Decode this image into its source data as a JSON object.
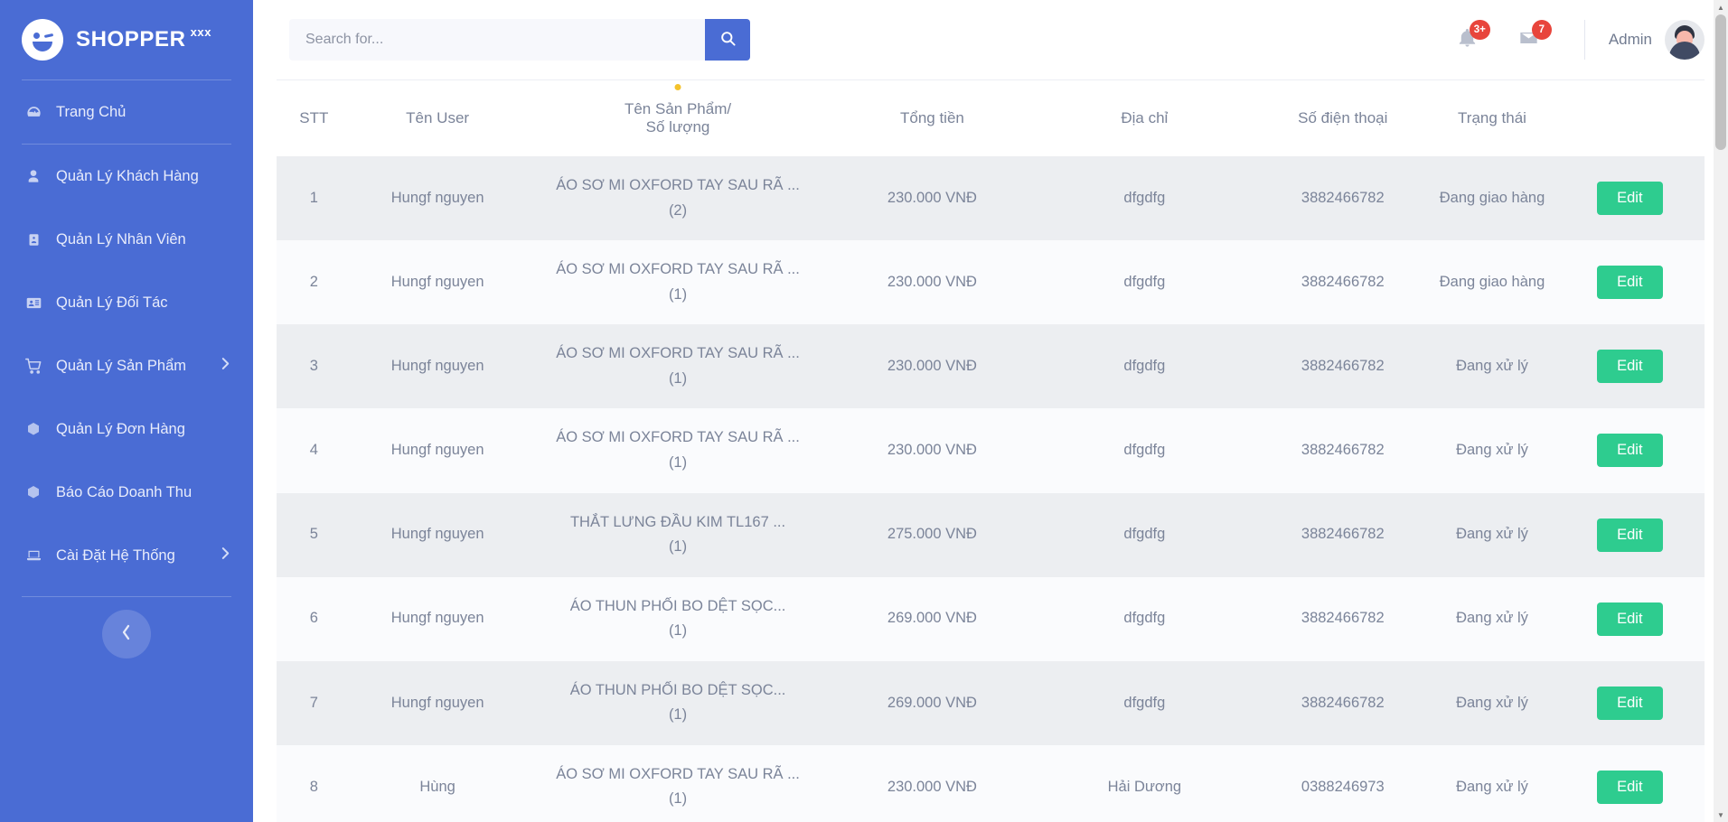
{
  "brand": {
    "name": "SHOPPER",
    "sup": "xxx",
    "logo_icon": "wink-smiley-icon"
  },
  "sidebar": {
    "items": [
      {
        "label": "Trang Chủ",
        "icon": "dashboard-icon",
        "has_arrow": false
      },
      {
        "label": "Quản Lý Khách Hàng",
        "icon": "user-icon",
        "has_arrow": false
      },
      {
        "label": "Quản Lý Nhân Viên",
        "icon": "id-badge-icon",
        "has_arrow": false
      },
      {
        "label": "Quản Lý Đối Tác",
        "icon": "id-card-icon",
        "has_arrow": false
      },
      {
        "label": "Quản Lý Sản Phẩm",
        "icon": "cart-icon",
        "has_arrow": true
      },
      {
        "label": "Quản Lý Đơn Hàng",
        "icon": "box-icon",
        "has_arrow": false
      },
      {
        "label": "Báo Cáo Doanh Thu",
        "icon": "box-icon",
        "has_arrow": false
      },
      {
        "label": "Cài Đặt Hệ Thống",
        "icon": "laptop-icon",
        "has_arrow": true
      }
    ],
    "collapse_icon": "chevron-left-icon",
    "bg_color": "#4a6cd4"
  },
  "topbar": {
    "search_placeholder": "Search for...",
    "search_value": "",
    "search_icon": "search-icon",
    "notifications": {
      "icon": "bell-icon",
      "badge": "3+"
    },
    "messages": {
      "icon": "envelope-icon",
      "badge": "7"
    },
    "user_name": "Admin",
    "avatar_icon": "avatar",
    "badge_color": "#e8453c",
    "accent_color": "#4a6cd4"
  },
  "table": {
    "headers": {
      "stt": "STT",
      "user": "Tên User",
      "product_line1": "Tên Sản Phẩm/",
      "product_line2": "Số lượng",
      "total": "Tổng tiền",
      "address": "Địa chỉ",
      "phone": "Số điện thoại",
      "status": "Trạng thái"
    },
    "action_label": "Edit",
    "action_color": "#2ecc8f",
    "rows": [
      {
        "stt": "1",
        "user": "Hungf nguyen",
        "product": "ÁO SƠ MI OXFORD TAY SAU RÃ ...",
        "qty": "(2)",
        "total": "230.000 VNĐ",
        "address": "dfgdfg",
        "phone": "3882466782",
        "status": "Đang giao hàng",
        "action": "Edit"
      },
      {
        "stt": "2",
        "user": "Hungf nguyen",
        "product": "ÁO SƠ MI OXFORD TAY SAU RÃ ...",
        "qty": "(1)",
        "total": "230.000 VNĐ",
        "address": "dfgdfg",
        "phone": "3882466782",
        "status": "Đang giao hàng",
        "action": "Edit"
      },
      {
        "stt": "3",
        "user": "Hungf nguyen",
        "product": "ÁO SƠ MI OXFORD TAY SAU RÃ ...",
        "qty": "(1)",
        "total": "230.000 VNĐ",
        "address": "dfgdfg",
        "phone": "3882466782",
        "status": "Đang xử lý",
        "action": "Edit"
      },
      {
        "stt": "4",
        "user": "Hungf nguyen",
        "product": "ÁO SƠ MI OXFORD TAY SAU RÃ ...",
        "qty": "(1)",
        "total": "230.000 VNĐ",
        "address": "dfgdfg",
        "phone": "3882466782",
        "status": "Đang xử lý",
        "action": "Edit"
      },
      {
        "stt": "5",
        "user": "Hungf nguyen",
        "product": "THẮT LƯNG ĐẦU KIM TL167 ...",
        "qty": "(1)",
        "total": "275.000 VNĐ",
        "address": "dfgdfg",
        "phone": "3882466782",
        "status": "Đang xử lý",
        "action": "Edit"
      },
      {
        "stt": "6",
        "user": "Hungf nguyen",
        "product": "ÁO THUN PHỐI BO DỆT SỌC...",
        "qty": "(1)",
        "total": "269.000 VNĐ",
        "address": "dfgdfg",
        "phone": "3882466782",
        "status": "Đang xử lý",
        "action": "Edit"
      },
      {
        "stt": "7",
        "user": "Hungf nguyen",
        "product": "ÁO THUN PHỐI BO DỆT SỌC...",
        "qty": "(1)",
        "total": "269.000 VNĐ",
        "address": "dfgdfg",
        "phone": "3882466782",
        "status": "Đang xử lý",
        "action": "Edit"
      },
      {
        "stt": "8",
        "user": "Hùng",
        "product": "ÁO SƠ MI OXFORD TAY SAU RÃ ...",
        "qty": "(1)",
        "total": "230.000 VNĐ",
        "address": "Hải Dương",
        "phone": "0388246973",
        "status": "Đang xử lý",
        "action": "Edit"
      }
    ]
  }
}
